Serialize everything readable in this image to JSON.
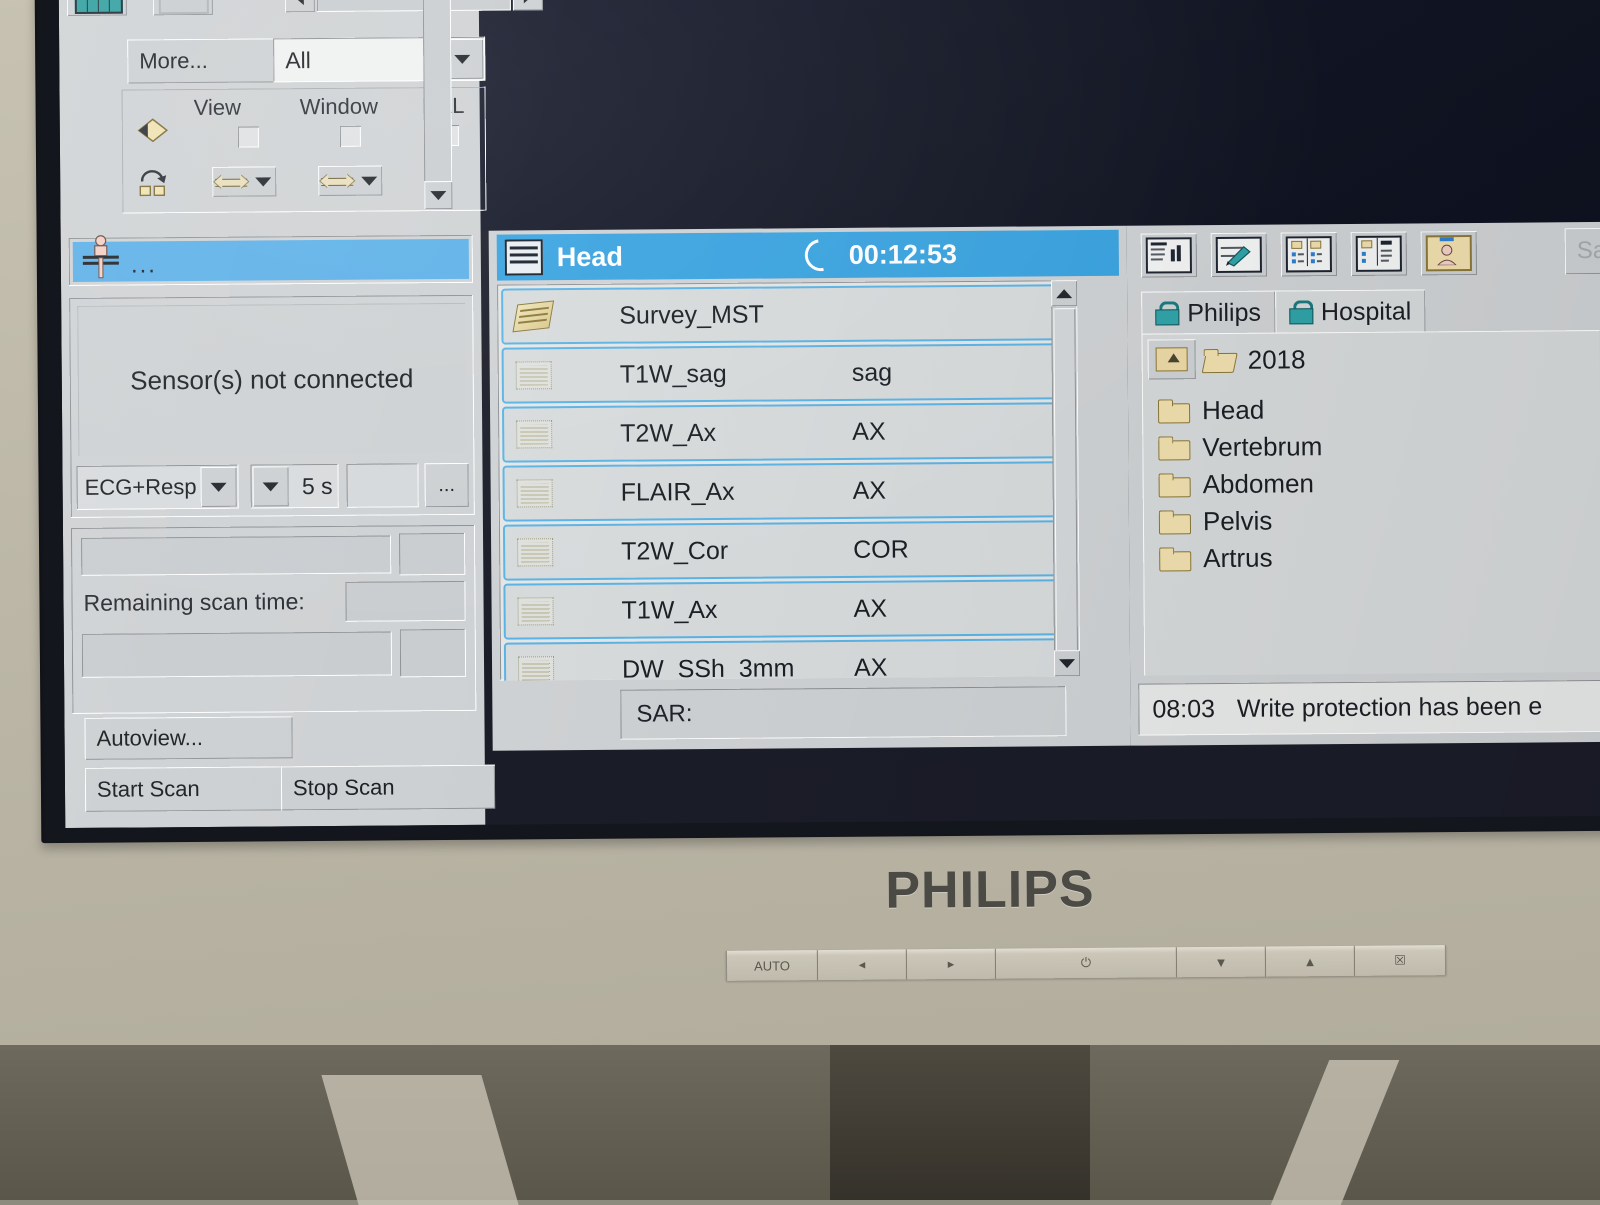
{
  "monitor": {
    "brand": "PHILIPS",
    "osd_buttons": [
      {
        "name": "auto-button",
        "label": "AUTO"
      },
      {
        "name": "left-button",
        "label": "◂"
      },
      {
        "name": "right-button",
        "label": "▸"
      },
      {
        "name": "power-button",
        "label": "⏻"
      },
      {
        "name": "down-button",
        "label": "▼"
      },
      {
        "name": "up-button",
        "label": "▲"
      },
      {
        "name": "menu-button",
        "label": "☒"
      }
    ]
  },
  "left_panel": {
    "more_button": "More...",
    "filter_combo": {
      "value": "All"
    },
    "view_group": {
      "headers": [
        "View",
        "Window",
        "RAL"
      ],
      "checkboxes": [
        false,
        false,
        false
      ]
    },
    "patient_strip": {
      "value": "..."
    },
    "sensor": {
      "status": "Sensor(s) not connected",
      "signal_combo": "ECG+Resp",
      "delay_value": "5 s",
      "more_button": "..."
    },
    "scan_time": {
      "label": "Remaining scan time:",
      "value": ""
    },
    "buttons": {
      "autoview": "Autoview...",
      "start": "Start Scan",
      "stop": "Stop Scan"
    }
  },
  "exam_panel": {
    "title": "Head",
    "timer": "00:12:53",
    "sar_label": "SAR:",
    "rows": [
      {
        "icon": "completed-scan-icon",
        "name": "Survey_MST",
        "orientation": ""
      },
      {
        "icon": "pending-scan-icon",
        "name": "T1W_sag",
        "orientation": "sag"
      },
      {
        "icon": "pending-scan-icon",
        "name": "T2W_Ax",
        "orientation": "AX"
      },
      {
        "icon": "pending-scan-icon",
        "name": "FLAIR_Ax",
        "orientation": "AX"
      },
      {
        "icon": "pending-scan-icon",
        "name": "T2W_Cor",
        "orientation": "COR"
      },
      {
        "icon": "pending-scan-icon",
        "name": "T1W_Ax",
        "orientation": "AX"
      },
      {
        "icon": "pending-scan-icon",
        "name": "DW_SSh_3mm",
        "orientation": "AX"
      }
    ]
  },
  "right_panel": {
    "toolbar": [
      {
        "name": "exam-card-icon"
      },
      {
        "name": "edit-protocol-icon"
      },
      {
        "name": "copy-protocol-icon"
      },
      {
        "name": "compare-protocol-icon"
      },
      {
        "name": "patient-folder-icon"
      }
    ],
    "tabs": [
      {
        "label": "Philips",
        "icon": "lock-icon",
        "active": false
      },
      {
        "label": "Hospital",
        "icon": "lock-icon",
        "active": true
      }
    ],
    "tree": {
      "root": "2018",
      "items": [
        "Head",
        "Vertebrum",
        "Abdomen",
        "Pelvis",
        "Artrus"
      ]
    },
    "save_button_partial": "Sa"
  },
  "status_bar": {
    "time": "08:03",
    "message": "Write protection has been e"
  },
  "colors": {
    "title_bar_blue": "#39a3e0",
    "selection_blue": "#5cb0e8",
    "panel_gray": "#cfd2d4",
    "row_border": "#5ab3e6",
    "viewport_navy": "#121624",
    "bezel_beige": "#bdb8a8"
  }
}
